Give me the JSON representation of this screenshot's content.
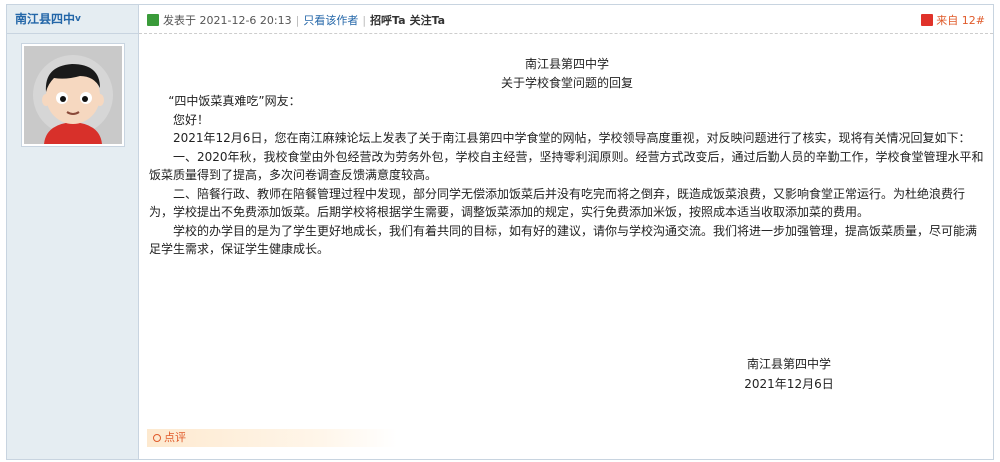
{
  "author": {
    "name": "南江县四中",
    "badge": "v"
  },
  "meta": {
    "posted_at": "发表于 2021-12-6 20:13",
    "author_only": "只看该作者",
    "greet": "招呼Ta",
    "follow": "关注Ta",
    "source": "来自",
    "floor": "12#"
  },
  "post": {
    "title_line1": "南江县第四中学",
    "title_line2": "关于学校食堂问题的回复",
    "salutation": "“四中饭菜真难吃”网友：",
    "hello": "您好！",
    "para1": "2021年12月6日，您在南江麻辣论坛上发表了关于南江县第四中学食堂的网帖，学校领导高度重视，对反映问题进行了核实，现将有关情况回复如下：",
    "para2": "一、2020年秋，我校食堂由外包经营改为劳务外包，学校自主经营，坚持零利润原则。经营方式改变后，通过后勤人员的辛勤工作，学校食堂管理水平和饭菜质量得到了提高，多次问卷调查反馈满意度较高。",
    "para3": "二、陪餐行政、教师在陪餐管理过程中发现，部分同学无偿添加饭菜后并没有吃完而将之倒弃，既造成饭菜浪费，又影响食堂正常运行。为杜绝浪费行为，学校提出不免费添加饭菜。后期学校将根据学生需要，调整饭菜添加的规定，实行免费添加米饭，按照成本适当收取添加菜的费用。",
    "para4": "学校的办学目的是为了学生更好地成长，我们有着共同的目标，如有好的建议，请你与学校沟通交流。我们将进一步加强管理，提高饭菜质量，尽可能满足学生需求，保证学生健康成长。",
    "sign_name": "南江县第四中学",
    "sign_date": "2021年12月6日"
  },
  "actions": {
    "comment": "点评"
  },
  "icons": {
    "online": "online-status-icon",
    "source": "source-badge-icon",
    "comment": "comment-ring-icon",
    "avatar": "cartoon-boy-avatar"
  },
  "colors": {
    "link": "#2366a8",
    "sidebar_bg": "#e5edf2",
    "accent": "#e05a2a"
  }
}
